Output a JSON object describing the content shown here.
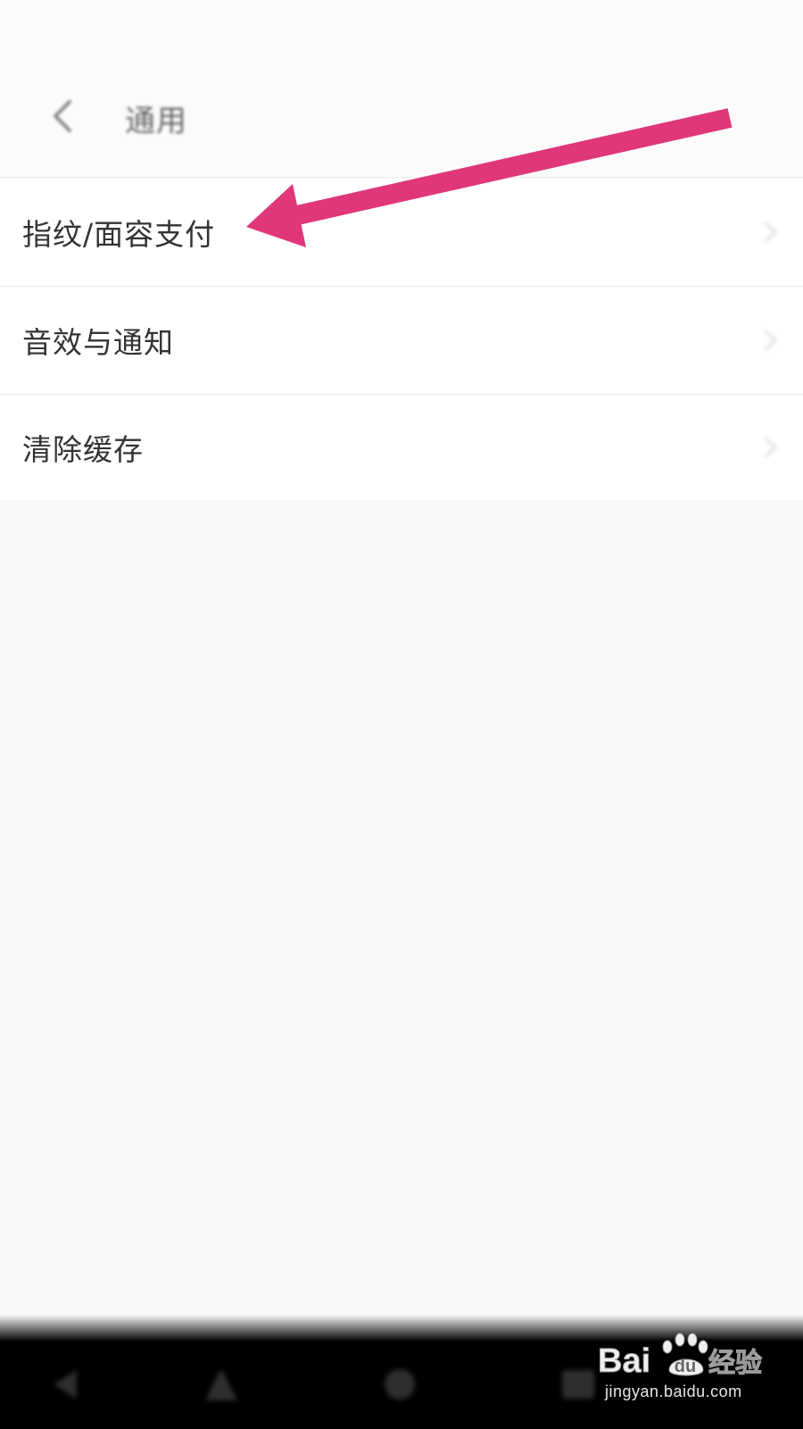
{
  "header": {
    "back_icon": "chevron-left-icon",
    "title": "通用"
  },
  "list": {
    "items": [
      {
        "label": "指纹/面容支付",
        "icon": "chevron-right-icon"
      },
      {
        "label": "音效与通知",
        "icon": "chevron-right-icon"
      },
      {
        "label": "清除缓存",
        "icon": "chevron-right-icon"
      }
    ]
  },
  "annotation": {
    "type": "arrow",
    "color": "#e0367a",
    "points_to": "指纹/面容支付"
  },
  "navbar": {
    "icons": [
      "nav-back-icon",
      "nav-home-icon",
      "nav-recents-icon",
      "nav-menu-icon"
    ]
  },
  "watermark": {
    "brand": "Baidu经验",
    "url": "jingyan.baidu.com"
  },
  "colors": {
    "background": "#f8f8f8",
    "list_background": "#ffffff",
    "text_primary": "#333333",
    "title_text": "#666666",
    "annotation": "#e0367a",
    "navbar": "#000000"
  }
}
